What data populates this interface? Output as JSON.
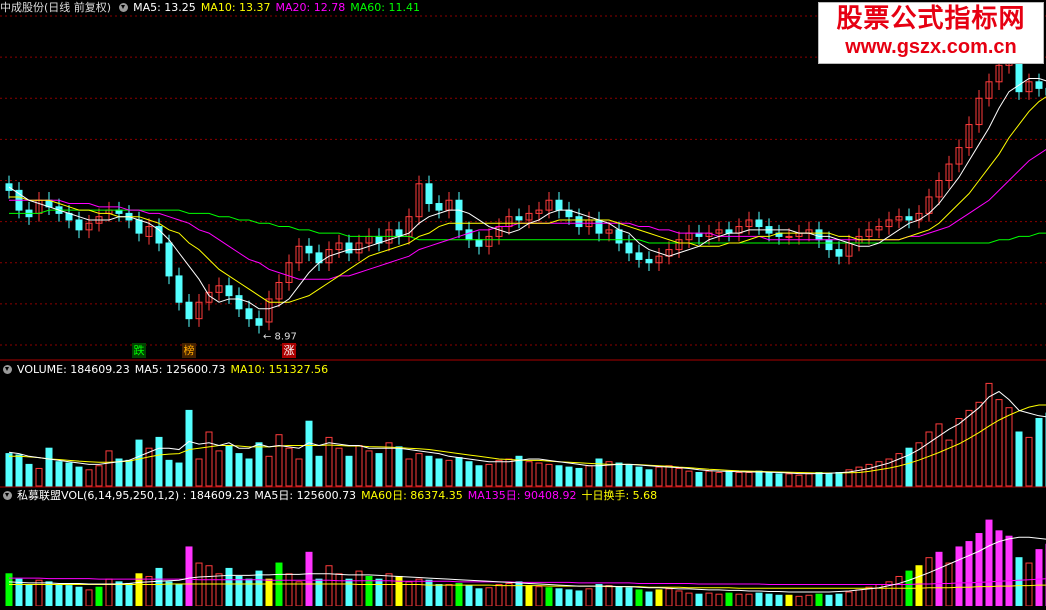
{
  "main": {
    "title": "中成股份(日线 前复权)",
    "ma": [
      {
        "label": "MA5: 13.25",
        "color": "#ffffff"
      },
      {
        "label": "MA10: 13.37",
        "color": "#ffff00"
      },
      {
        "label": "MA20: 12.78",
        "color": "#ff00ff"
      },
      {
        "label": "MA60: 11.41",
        "color": "#00ff00"
      }
    ],
    "low_marker": "8.97",
    "tags": [
      {
        "text": "跌",
        "color": "#00ff00",
        "bg": "#004400",
        "idx": 13
      },
      {
        "text": "榜",
        "color": "#ffaa00",
        "bg": "#442200",
        "idx": 18
      },
      {
        "text": "涨",
        "color": "#ffffff",
        "bg": "#aa0000",
        "idx": 28
      }
    ]
  },
  "volume": {
    "header": [
      {
        "label": "VOLUME: 184609.23",
        "color": "#ffffff"
      },
      {
        "label": "MA5: 125600.73",
        "color": "#ffffff"
      },
      {
        "label": "MA10: 151327.56",
        "color": "#ffff00"
      }
    ]
  },
  "indicator": {
    "header": [
      {
        "label": "私募联盟VOL(6,14,95,250,1,2)  : 184609.23",
        "color": "#ffffff"
      },
      {
        "label": "MA5日: 125600.73",
        "color": "#ffffff"
      },
      {
        "label": "MA60日: 86374.35",
        "color": "#ffff00"
      },
      {
        "label": "MA135日: 90408.92",
        "color": "#ff00ff"
      },
      {
        "label": "十日换手: 5.68",
        "color": "#ffff00"
      }
    ]
  },
  "watermark": {
    "line1": "股票公式指标网",
    "line2": "www.gszx.com.cn"
  },
  "colors": {
    "up": "#ff3c3c",
    "down": "#54ffff",
    "grid": "#8b0000",
    "ma5": "#ffffff",
    "ma10": "#ffff00",
    "ma20": "#ff00ff",
    "ma60": "#00ff00"
  },
  "chart_data": {
    "type": "candlestick",
    "close": [
      13.2,
      12.6,
      12.4,
      12.9,
      12.7,
      12.5,
      12.3,
      12.0,
      12.2,
      12.4,
      12.6,
      12.5,
      12.3,
      11.9,
      12.1,
      11.6,
      10.6,
      9.8,
      9.3,
      9.8,
      10.1,
      10.3,
      10.0,
      9.6,
      9.3,
      9.1,
      9.9,
      10.4,
      11.0,
      11.5,
      11.3,
      11.0,
      11.4,
      11.6,
      11.3,
      11.6,
      11.8,
      11.6,
      12.0,
      11.8,
      12.4,
      13.4,
      12.8,
      12.6,
      12.9,
      12.0,
      11.7,
      11.5,
      11.8,
      12.1,
      12.4,
      12.3,
      12.5,
      12.6,
      12.9,
      12.6,
      12.4,
      12.1,
      12.3,
      11.9,
      12.0,
      11.6,
      11.3,
      11.1,
      11.0,
      11.2,
      11.4,
      11.7,
      11.9,
      11.8,
      11.9,
      12.0,
      11.9,
      12.1,
      12.3,
      12.1,
      11.9,
      11.8,
      11.8,
      11.9,
      12.0,
      11.7,
      11.4,
      11.2,
      11.6,
      11.8,
      12.0,
      12.1,
      12.3,
      12.4,
      12.3,
      12.5,
      13.0,
      13.5,
      14.0,
      14.5,
      15.2,
      16.0,
      16.5,
      17.0,
      17.2,
      16.2,
      16.5,
      16.3,
      16.1,
      16.3
    ],
    "open": [
      13.4,
      13.2,
      12.6,
      12.5,
      12.9,
      12.7,
      12.5,
      12.3,
      12.0,
      12.2,
      12.5,
      12.6,
      12.5,
      12.3,
      11.8,
      12.1,
      11.6,
      10.6,
      9.8,
      9.3,
      9.8,
      10.1,
      10.3,
      10.0,
      9.6,
      9.3,
      9.2,
      9.9,
      10.4,
      11.0,
      11.5,
      11.3,
      11.0,
      11.4,
      11.6,
      11.3,
      11.6,
      11.8,
      11.6,
      12.0,
      11.8,
      12.4,
      13.4,
      12.8,
      12.6,
      12.9,
      12.0,
      11.7,
      11.5,
      11.8,
      12.1,
      12.4,
      12.3,
      12.5,
      12.6,
      12.9,
      12.6,
      12.4,
      12.1,
      12.3,
      11.9,
      12.0,
      11.6,
      11.3,
      11.1,
      11.0,
      11.2,
      11.4,
      11.7,
      11.9,
      11.8,
      11.9,
      12.0,
      11.9,
      12.1,
      12.3,
      12.1,
      11.9,
      11.8,
      11.8,
      11.9,
      12.0,
      11.7,
      11.4,
      11.2,
      11.6,
      11.8,
      12.0,
      12.1,
      12.3,
      12.4,
      12.3,
      12.5,
      13.0,
      13.5,
      14.0,
      14.5,
      15.2,
      16.0,
      16.5,
      17.0,
      17.2,
      16.2,
      16.5,
      16.3,
      16.1
    ],
    "ma5": [
      13.3,
      13.1,
      12.9,
      12.8,
      12.7,
      12.6,
      12.5,
      12.4,
      12.3,
      12.3,
      12.3,
      12.4,
      12.4,
      12.3,
      12.2,
      12.0,
      11.7,
      11.3,
      10.9,
      10.5,
      10.0,
      9.8,
      9.9,
      9.9,
      9.8,
      9.6,
      9.6,
      9.7,
      9.9,
      10.3,
      10.7,
      11.0,
      11.2,
      11.3,
      11.4,
      11.4,
      11.5,
      11.6,
      11.7,
      11.8,
      11.9,
      12.2,
      12.4,
      12.5,
      12.6,
      12.6,
      12.5,
      12.3,
      12.1,
      12.0,
      11.9,
      12.0,
      12.2,
      12.3,
      12.5,
      12.6,
      12.6,
      12.5,
      12.4,
      12.3,
      12.2,
      12.0,
      11.9,
      11.6,
      11.4,
      11.3,
      11.2,
      11.3,
      11.4,
      11.5,
      11.7,
      11.8,
      11.9,
      11.9,
      12.0,
      12.0,
      12.0,
      12.0,
      12.0,
      11.9,
      11.9,
      11.8,
      11.8,
      11.7,
      11.6,
      11.5,
      11.5,
      11.6,
      11.8,
      12.0,
      12.2,
      12.3,
      12.5,
      12.8,
      13.2,
      13.6,
      14.1,
      14.6,
      15.1,
      15.7,
      16.2,
      16.4,
      16.6,
      16.6,
      16.5,
      16.3
    ],
    "ma10": [
      13.0,
      13.0,
      12.9,
      12.9,
      12.9,
      12.8,
      12.7,
      12.6,
      12.6,
      12.5,
      12.5,
      12.4,
      12.4,
      12.4,
      12.3,
      12.2,
      12.0,
      11.9,
      11.6,
      11.4,
      11.1,
      10.8,
      10.6,
      10.4,
      10.2,
      10.0,
      9.8,
      9.8,
      9.8,
      9.9,
      10.0,
      10.2,
      10.4,
      10.6,
      10.8,
      11.0,
      11.2,
      11.3,
      11.4,
      11.5,
      11.6,
      11.8,
      11.9,
      12.1,
      12.2,
      12.2,
      12.2,
      12.2,
      12.2,
      12.2,
      12.2,
      12.2,
      12.2,
      12.2,
      12.2,
      12.3,
      12.3,
      12.3,
      12.3,
      12.3,
      12.3,
      12.2,
      12.1,
      12.0,
      11.9,
      11.8,
      11.7,
      11.6,
      11.6,
      11.5,
      11.5,
      11.5,
      11.6,
      11.6,
      11.7,
      11.8,
      11.8,
      11.9,
      11.9,
      11.9,
      11.9,
      11.9,
      11.9,
      11.8,
      11.8,
      11.7,
      11.7,
      11.7,
      11.7,
      11.7,
      11.8,
      11.9,
      12.0,
      12.2,
      12.5,
      12.8,
      13.1,
      13.5,
      13.9,
      14.3,
      14.8,
      15.2,
      15.6,
      15.9,
      16.1,
      16.3
    ],
    "ma20": [
      12.9,
      12.9,
      12.9,
      12.9,
      12.9,
      12.9,
      12.8,
      12.8,
      12.8,
      12.7,
      12.7,
      12.7,
      12.6,
      12.6,
      12.5,
      12.5,
      12.4,
      12.3,
      12.2,
      12.0,
      11.9,
      11.7,
      11.5,
      11.3,
      11.1,
      11.0,
      10.8,
      10.7,
      10.6,
      10.5,
      10.5,
      10.5,
      10.5,
      10.6,
      10.6,
      10.7,
      10.8,
      10.9,
      11.0,
      11.1,
      11.2,
      11.4,
      11.5,
      11.6,
      11.7,
      11.8,
      11.9,
      12.0,
      12.0,
      12.1,
      12.1,
      12.2,
      12.2,
      12.2,
      12.2,
      12.2,
      12.2,
      12.2,
      12.2,
      12.2,
      12.2,
      12.2,
      12.2,
      12.1,
      12.1,
      12.0,
      12.0,
      11.9,
      11.9,
      11.9,
      11.9,
      11.8,
      11.8,
      11.8,
      11.8,
      11.8,
      11.7,
      11.7,
      11.7,
      11.7,
      11.7,
      11.7,
      11.7,
      11.7,
      11.7,
      11.7,
      11.7,
      11.7,
      11.7,
      11.7,
      11.8,
      11.8,
      11.9,
      12.0,
      12.1,
      12.3,
      12.5,
      12.7,
      12.9,
      13.2,
      13.5,
      13.8,
      14.1,
      14.3,
      14.5,
      14.7
    ],
    "ma60": [
      12.5,
      12.5,
      12.5,
      12.5,
      12.6,
      12.6,
      12.6,
      12.6,
      12.6,
      12.6,
      12.6,
      12.6,
      12.6,
      12.6,
      12.6,
      12.6,
      12.6,
      12.6,
      12.5,
      12.5,
      12.5,
      12.4,
      12.4,
      12.3,
      12.3,
      12.2,
      12.2,
      12.1,
      12.1,
      12.0,
      12.0,
      11.9,
      11.9,
      11.9,
      11.8,
      11.8,
      11.8,
      11.8,
      11.8,
      11.8,
      11.8,
      11.7,
      11.7,
      11.7,
      11.7,
      11.7,
      11.7,
      11.7,
      11.7,
      11.7,
      11.7,
      11.7,
      11.7,
      11.7,
      11.7,
      11.7,
      11.7,
      11.7,
      11.7,
      11.7,
      11.7,
      11.7,
      11.7,
      11.7,
      11.6,
      11.6,
      11.6,
      11.6,
      11.6,
      11.6,
      11.6,
      11.6,
      11.6,
      11.6,
      11.6,
      11.6,
      11.6,
      11.6,
      11.6,
      11.6,
      11.6,
      11.6,
      11.6,
      11.6,
      11.6,
      11.6,
      11.6,
      11.6,
      11.6,
      11.6,
      11.6,
      11.6,
      11.6,
      11.6,
      11.6,
      11.6,
      11.6,
      11.6,
      11.6,
      11.7,
      11.7,
      11.8,
      11.8,
      11.9,
      11.9,
      12.0
    ],
    "volume": [
      120,
      115,
      80,
      65,
      140,
      90,
      85,
      70,
      60,
      75,
      130,
      100,
      95,
      170,
      140,
      180,
      95,
      85,
      280,
      100,
      200,
      130,
      150,
      120,
      100,
      160,
      110,
      190,
      140,
      100,
      240,
      110,
      180,
      140,
      110,
      150,
      130,
      120,
      160,
      145,
      100,
      120,
      110,
      100,
      95,
      105,
      90,
      75,
      80,
      95,
      100,
      110,
      90,
      85,
      80,
      75,
      70,
      65,
      75,
      100,
      90,
      85,
      80,
      70,
      60,
      70,
      75,
      65,
      55,
      50,
      55,
      50,
      55,
      50,
      50,
      55,
      50,
      45,
      45,
      40,
      45,
      50,
      45,
      50,
      60,
      70,
      80,
      90,
      100,
      120,
      140,
      160,
      200,
      230,
      170,
      250,
      280,
      310,
      380,
      320,
      290,
      200,
      180,
      250,
      270,
      185
    ],
    "ma5vol": [
      125,
      120,
      110,
      105,
      100,
      95,
      90,
      85,
      80,
      80,
      85,
      90,
      95,
      110,
      125,
      140,
      140,
      135,
      165,
      155,
      160,
      150,
      160,
      140,
      140,
      155,
      145,
      150,
      145,
      140,
      160,
      150,
      160,
      155,
      150,
      150,
      140,
      140,
      140,
      140,
      135,
      130,
      125,
      120,
      110,
      105,
      100,
      95,
      90,
      90,
      90,
      95,
      100,
      100,
      95,
      90,
      85,
      80,
      75,
      75,
      78,
      80,
      80,
      78,
      75,
      72,
      70,
      68,
      65,
      60,
      57,
      55,
      54,
      53,
      52,
      52,
      51,
      50,
      48,
      46,
      46,
      46,
      47,
      49,
      52,
      58,
      65,
      75,
      85,
      100,
      115,
      135,
      160,
      185,
      210,
      230,
      260,
      290,
      330,
      350,
      320,
      280,
      270,
      260,
      255,
      250
    ],
    "ma10vol": [
      110,
      110,
      108,
      105,
      100,
      98,
      95,
      92,
      90,
      88,
      88,
      90,
      92,
      100,
      108,
      115,
      118,
      120,
      135,
      140,
      145,
      150,
      150,
      148,
      145,
      145,
      145,
      148,
      150,
      150,
      150,
      150,
      152,
      150,
      148,
      148,
      146,
      145,
      144,
      142,
      140,
      138,
      135,
      130,
      125,
      120,
      115,
      110,
      105,
      100,
      98,
      96,
      95,
      95,
      92,
      90,
      88,
      86,
      84,
      82,
      80,
      80,
      80,
      79,
      77,
      75,
      73,
      70,
      68,
      65,
      62,
      60,
      58,
      56,
      55,
      54,
      53,
      52,
      51,
      50,
      49,
      48,
      48,
      48,
      49,
      50,
      54,
      60,
      66,
      74,
      84,
      96,
      110,
      124,
      140,
      156,
      176,
      198,
      222,
      244,
      262,
      278,
      292,
      300,
      300,
      290
    ],
    "ind_volume": [
      60,
      50,
      40,
      48,
      45,
      40,
      38,
      35,
      30,
      35,
      50,
      45,
      42,
      60,
      55,
      70,
      45,
      40,
      110,
      80,
      75,
      60,
      70,
      55,
      50,
      65,
      50,
      80,
      60,
      45,
      100,
      50,
      75,
      60,
      50,
      65,
      55,
      50,
      60,
      55,
      45,
      50,
      48,
      40,
      40,
      42,
      38,
      32,
      34,
      40,
      42,
      45,
      38,
      36,
      34,
      32,
      30,
      28,
      32,
      40,
      38,
      36,
      34,
      30,
      26,
      30,
      32,
      28,
      24,
      22,
      24,
      22,
      24,
      22,
      22,
      24,
      22,
      20,
      20,
      18,
      20,
      22,
      20,
      22,
      26,
      30,
      35,
      40,
      45,
      55,
      65,
      75,
      90,
      100,
      80,
      110,
      120,
      135,
      160,
      140,
      130,
      90,
      80,
      105,
      115,
      80
    ],
    "ind_ma": [
      45,
      44,
      43,
      43,
      43,
      42,
      42,
      42,
      41,
      41,
      41,
      41,
      42,
      44,
      45,
      46,
      47,
      48,
      52,
      54,
      55,
      56,
      57,
      57,
      57,
      58,
      58,
      59,
      59,
      59,
      60,
      60,
      60,
      59,
      58,
      58,
      58,
      57,
      56,
      55,
      54,
      53,
      52,
      51,
      50,
      49,
      48,
      47,
      46,
      45,
      44,
      43,
      42,
      41,
      40,
      39,
      38,
      37,
      37,
      37,
      37,
      36,
      36,
      35,
      34,
      34,
      33,
      32,
      32,
      31,
      30,
      30,
      29,
      29,
      28,
      28,
      27,
      27,
      26,
      26,
      26,
      26,
      26,
      27,
      28,
      30,
      32,
      34,
      38,
      42,
      48,
      55,
      62,
      70,
      78,
      86,
      94,
      102,
      112,
      120,
      125,
      128,
      128,
      126,
      124,
      122
    ],
    "ind_ma135": [
      52,
      52,
      52,
      52,
      51,
      51,
      51,
      51,
      51,
      50,
      50,
      50,
      50,
      50,
      50,
      50,
      50,
      50,
      50,
      49,
      49,
      49,
      49,
      49,
      49,
      49,
      48,
      48,
      48,
      48,
      48,
      48,
      48,
      47,
      47,
      47,
      47,
      47,
      47,
      46,
      46,
      46,
      46,
      46,
      46,
      45,
      45,
      45,
      45,
      45,
      45,
      44,
      44,
      44,
      44,
      44,
      44,
      43,
      43,
      43,
      43,
      43,
      43,
      42,
      42,
      42,
      42,
      42,
      42,
      41,
      41,
      41,
      41,
      41,
      41,
      41,
      40,
      40,
      40,
      40,
      40,
      40,
      40,
      40,
      40,
      40,
      40,
      40,
      40,
      40,
      40,
      41,
      41,
      42,
      42,
      43,
      43,
      44,
      45,
      46,
      47,
      48,
      49,
      50,
      51,
      52
    ],
    "ind_ma60": [
      40,
      40,
      40,
      40,
      40,
      40,
      40,
      40,
      40,
      40,
      40,
      40,
      40,
      40,
      40,
      40,
      41,
      41,
      41,
      41,
      41,
      41,
      41,
      41,
      41,
      41,
      41,
      41,
      41,
      41,
      41,
      41,
      41,
      41,
      41,
      40,
      40,
      40,
      40,
      40,
      40,
      40,
      39,
      39,
      39,
      39,
      39,
      39,
      39,
      38,
      38,
      38,
      38,
      38,
      37,
      37,
      37,
      37,
      37,
      37,
      36,
      36,
      36,
      36,
      35,
      35,
      35,
      35,
      34,
      34,
      34,
      34,
      34,
      33,
      33,
      33,
      33,
      33,
      33,
      33,
      33,
      33,
      33,
      33,
      33,
      33,
      33,
      33,
      33,
      33,
      33,
      33,
      34,
      34,
      34,
      35,
      35,
      36,
      36,
      37,
      37,
      38,
      38,
      39,
      39,
      40
    ],
    "ylim": [
      8.5,
      18.5
    ],
    "vol_max": 400,
    "ind_max": 190
  }
}
